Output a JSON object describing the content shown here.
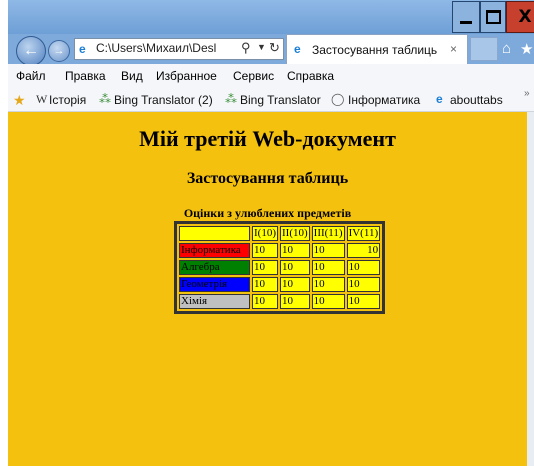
{
  "window": {
    "close_glyph": "X"
  },
  "navbar": {
    "address": "C:\\Users\\Михаил\\Desl",
    "search_glyph": "⚲",
    "tab_label": "Застосування таблиць",
    "tab_close": "×"
  },
  "menu": [
    "Файл",
    "Правка",
    "Вид",
    "Избранное",
    "Сервис",
    "Справка"
  ],
  "favorites": [
    {
      "label": "Історія",
      "icon": "W"
    },
    {
      "label": "Bing Translator (2)",
      "icon": "⁂"
    },
    {
      "label": "Bing Translator",
      "icon": "⁂"
    },
    {
      "label": "Інформатика",
      "icon": "◯"
    },
    {
      "label": "abouttabs",
      "icon": "e"
    }
  ],
  "page": {
    "heading": "Мій третій Web-документ",
    "subheading": "Застосування таблиць",
    "caption": "Оцінки з улюблених предметів",
    "table": {
      "headers": [
        "",
        "I(10)",
        "II(10)",
        "III(11)",
        "IV(11)"
      ],
      "rows": [
        {
          "subject": "Інформатика",
          "color": "#ff0000",
          "grades": [
            "10",
            "10",
            "10",
            "10"
          ]
        },
        {
          "subject": "Алгебра",
          "color": "#008000",
          "grades": [
            "10",
            "10",
            "10",
            "10"
          ]
        },
        {
          "subject": "Геометрія",
          "color": "#0000ff",
          "grades": [
            "10",
            "10",
            "10",
            "10"
          ]
        },
        {
          "subject": "Хімія",
          "color": "#c0c0c0",
          "grades": [
            "10",
            "10",
            "10",
            "10"
          ]
        }
      ]
    }
  },
  "colors": {
    "page_background": "#f4c10e",
    "cell_background": "#ffff00"
  }
}
